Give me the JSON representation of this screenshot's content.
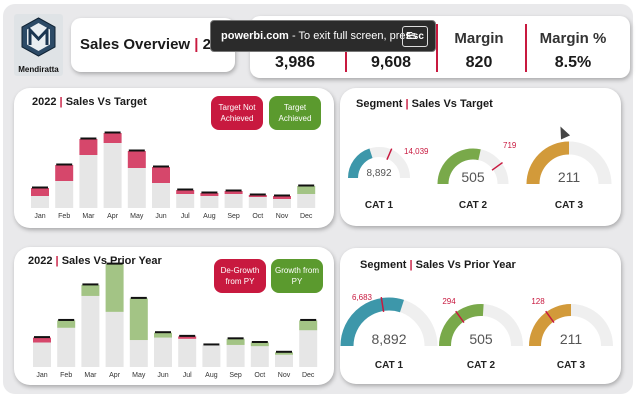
{
  "logo": {
    "name": "Mendiratta"
  },
  "title": {
    "main": "Sales Overview",
    "sep": "|",
    "year": "202"
  },
  "toast": {
    "host": "powerbi.com",
    "message": "- To exit full screen, press",
    "key": "Esc"
  },
  "kpis": [
    {
      "label": "",
      "value": "3,986"
    },
    {
      "label": "",
      "value": "9,608"
    },
    {
      "label": "Margin",
      "value": "820"
    },
    {
      "label": "Margin %",
      "value": "8.5%"
    }
  ],
  "colors": {
    "accent": "#c8193f",
    "grey": "#e6e6e6",
    "red_fill": "#d6476b",
    "green_fill": "#a3c485",
    "teal": "#3d97aa",
    "green": "#79a94a",
    "gold": "#d29a3a"
  },
  "panel1": {
    "title_year": "2022",
    "title_sep": "|",
    "title_rest": "Sales Vs Target",
    "legend_red": "Target Not Achieved",
    "legend_green": "Target Achieved",
    "chart_data": {
      "type": "bar",
      "categories": [
        "Jan",
        "Feb",
        "Mar",
        "Apr",
        "May",
        "Jun",
        "Jul",
        "Aug",
        "Sep",
        "Oct",
        "Nov",
        "Dec"
      ],
      "series": [
        {
          "name": "",
          "values": [
            12,
            27,
            53,
            65,
            40,
            25,
            14,
            12,
            14,
            11,
            9,
            14
          ]
        },
        {
          "name": "",
          "values": [
            20,
            43,
            69,
            75,
            57,
            41,
            18,
            15,
            17,
            13,
            12,
            22
          ]
        }
      ]
    }
  },
  "panel2": {
    "title_year": "2022",
    "title_sep": "|",
    "title_rest": "Sales Vs Prior Year",
    "legend_red": "De-Growth from PY",
    "legend_green": "Growth from PY",
    "chart_data": {
      "type": "bar",
      "categories": [
        "Jan",
        "Feb",
        "Mar",
        "Apr",
        "May",
        "Jun",
        "Jul",
        "Aug",
        "Sep",
        "Oct",
        "Nov",
        "Dec"
      ],
      "series": [
        {
          "name": "",
          "values": [
            20,
            32,
            58,
            45,
            22,
            24,
            23,
            18,
            18,
            17,
            10,
            30
          ]
        },
        {
          "name": "",
          "values": [
            24,
            38,
            67,
            84,
            56,
            28,
            25,
            18,
            23,
            20,
            12,
            38
          ]
        }
      ]
    }
  },
  "segment_target": {
    "title_a": "Segment",
    "title_sep": "|",
    "title_b": "Sales Vs Target",
    "gauges": [
      {
        "cat": "CAT 1",
        "value": "8,892",
        "target": "14,039",
        "fill": 0.4,
        "tpos": 0.63,
        "color": "#3d97aa",
        "big": false
      },
      {
        "cat": "CAT 2",
        "value": "505",
        "target": "719",
        "fill": 0.57,
        "tpos": 0.8,
        "color": "#79a94a",
        "big": true
      },
      {
        "cat": "CAT 3",
        "value": "211",
        "target": "",
        "fill": 0.5,
        "tpos": -1,
        "color": "#d29a3a",
        "big": true
      }
    ]
  },
  "segment_py": {
    "title_a": "Segment",
    "title_sep": "|",
    "title_b": "Sales Vs Prior Year",
    "gauges": [
      {
        "cat": "CAT 1",
        "value": "8,892",
        "target": "6,683",
        "fill": 0.6,
        "tpos": 0.45,
        "color": "#3d97aa",
        "big": true
      },
      {
        "cat": "CAT 2",
        "value": "505",
        "target": "294",
        "fill": 0.52,
        "tpos": 0.3,
        "color": "#79a94a",
        "big": true
      },
      {
        "cat": "CAT 3",
        "value": "211",
        "target": "128",
        "fill": 0.5,
        "tpos": 0.3,
        "color": "#d29a3a",
        "big": true
      }
    ]
  }
}
